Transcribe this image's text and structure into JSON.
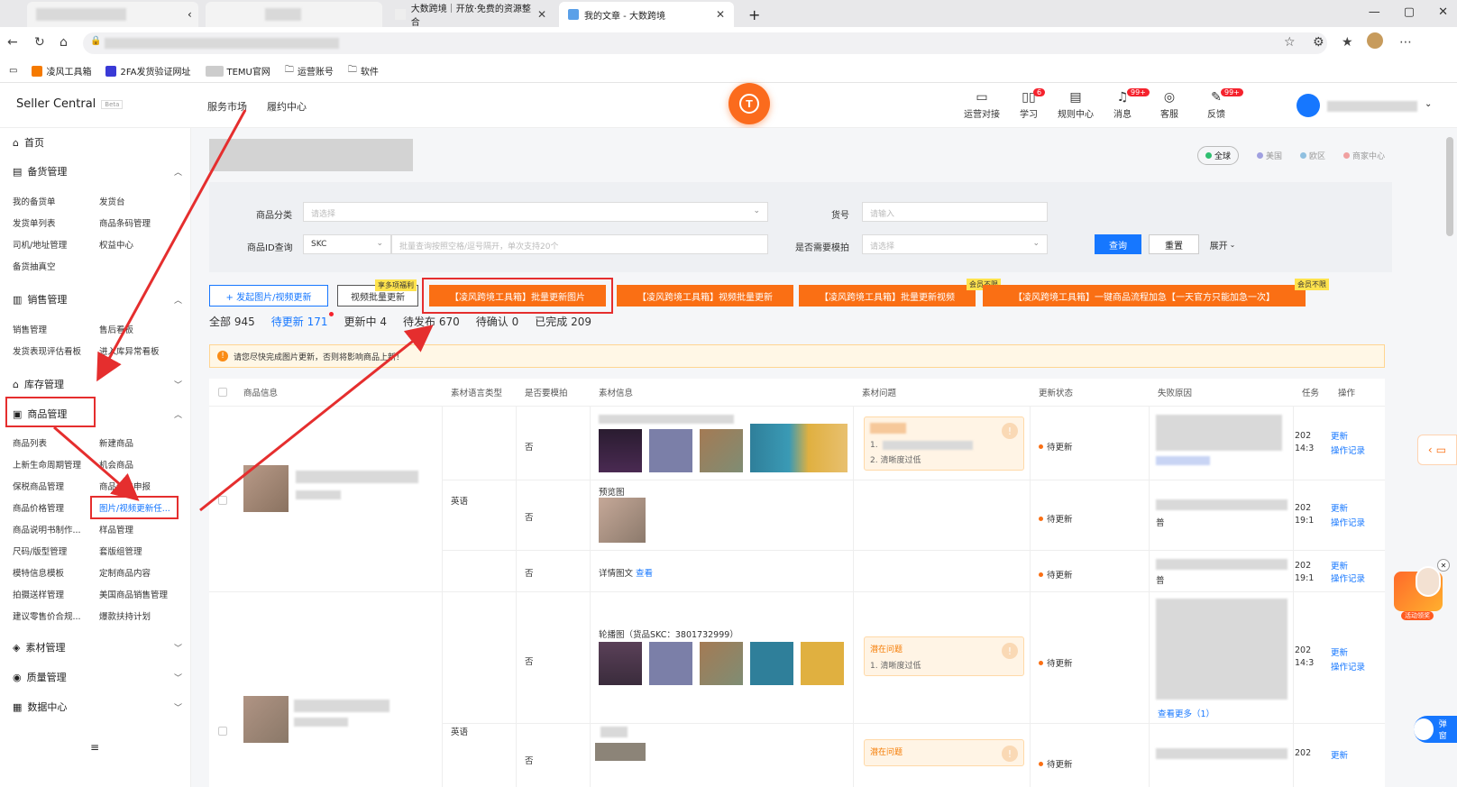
{
  "browser": {
    "tabs": [
      {
        "label": "大数跨境｜开放·免费的资源整合"
      },
      {
        "label": "我的文章 - 大数跨境"
      }
    ],
    "new_tab": "+",
    "window_controls": [
      "—",
      "▢",
      "✕"
    ]
  },
  "bookmarks": [
    {
      "label": "凌风工具箱",
      "color": "#f57a00"
    },
    {
      "label": "2FA发货验证网址",
      "color": "#3a3ad6"
    },
    {
      "label": "TEMU官网",
      "color": "#cccccc"
    },
    {
      "label": "运营账号",
      "color": ""
    },
    {
      "label": "软件",
      "color": ""
    }
  ],
  "header": {
    "brand": "Seller Central",
    "beta": "Beta",
    "nav": [
      "服务市场",
      "履约中心"
    ],
    "icons": [
      {
        "label": "运营对接",
        "icon": "chat-icon",
        "badge": ""
      },
      {
        "label": "学习",
        "icon": "book-icon",
        "badge": "6"
      },
      {
        "label": "规则中心",
        "icon": "document-icon",
        "badge": ""
      },
      {
        "label": "消息",
        "icon": "bell-icon",
        "badge": "99+"
      },
      {
        "label": "客服",
        "icon": "headset-icon",
        "badge": ""
      },
      {
        "label": "反馈",
        "icon": "edit-icon",
        "badge": "99+"
      }
    ]
  },
  "sidebar": {
    "home": "首页",
    "groups": [
      {
        "label": "备货管理",
        "items": [
          "我的备货单",
          "发货台",
          "发货单列表",
          "商品条码管理",
          "司机/地址管理",
          "权益中心",
          "备货抽真空"
        ]
      },
      {
        "label": "销售管理",
        "items": [
          "销售管理",
          "售后看板",
          "发货表现评估看板",
          "进入库异常看板"
        ]
      },
      {
        "label": "库存管理",
        "items": []
      },
      {
        "label": "商品管理",
        "items": [
          "商品列表",
          "新建商品",
          "上新生命周期管理",
          "机会商品",
          "保税商品管理",
          "商品价格申报",
          "商品价格管理",
          "图片/视频更新任...",
          "商品说明书制作...",
          "样品管理",
          "尺码/版型管理",
          "套版组管理",
          "模特信息模板",
          "定制商品内容",
          "拍摄送样管理",
          "美国商品销售管理",
          "建议零售价合规...",
          "爆款扶持计划"
        ]
      },
      {
        "label": "素材管理",
        "items": []
      },
      {
        "label": "质量管理",
        "items": []
      },
      {
        "label": "数据中心",
        "items": []
      }
    ]
  },
  "region": {
    "options": [
      "全球",
      "美国",
      "欧区",
      "商家中心"
    ]
  },
  "filters": {
    "category_label": "商品分类",
    "category_placeholder": "请选择",
    "sku_label": "货号",
    "sku_placeholder": "请输入",
    "id_label": "商品ID查询",
    "id_type": "SKC",
    "id_placeholder": "批量查询按照空格/逗号隔开，单次支持20个",
    "model_label": "是否需要模拍",
    "model_placeholder": "请选择",
    "query": "查询",
    "reset": "重置",
    "expand": "展开"
  },
  "toolbar": {
    "upload": "+ 发起图片/视频更新",
    "video_batch": "视频批量更新",
    "ribbon_1": "享多项福利",
    "b1": "【凌风跨境工具箱】批量更新图片",
    "b2": "【凌风跨境工具箱】视频批量更新",
    "b3": "【凌风跨境工具箱】批量更新视频",
    "b4": "【凌风跨境工具箱】一键商品流程加急【一天官方只能加急一次】",
    "ribbon_2": "会员不限",
    "ribbon_3": "会员不限"
  },
  "status_tabs": [
    {
      "label": "全部",
      "count": "945"
    },
    {
      "label": "待更新",
      "count": "171"
    },
    {
      "label": "更新中",
      "count": "4"
    },
    {
      "label": "待发布",
      "count": "670"
    },
    {
      "label": "待确认",
      "count": "0"
    },
    {
      "label": "已完成",
      "count": "209"
    }
  ],
  "notice": "请您尽快完成图片更新，否则将影响商品上新！",
  "table": {
    "headers": [
      "商品信息",
      "素材语言类型",
      "是否要模拍",
      "素材信息",
      "素材问题",
      "更新状态",
      "失败原因",
      "任务",
      "操作"
    ],
    "rows": [
      {
        "lang": "英语",
        "model": "否",
        "material": "",
        "issue_title": "",
        "issue_lines": [
          "1.",
          "2. 清晰度过低"
        ],
        "status": "待更新",
        "task": "202",
        "time": "14:3",
        "op1": "更新",
        "op2": "操作记录"
      },
      {
        "lang": "",
        "model": "否",
        "material": "预览图",
        "issue_title": "",
        "issue_lines": [],
        "status": "待更新",
        "task": "202",
        "time": "19:1",
        "op1": "更新",
        "op2": "操作记录",
        "fail_word": "普"
      },
      {
        "lang": "",
        "model": "否",
        "material": "详情图文",
        "material_link": "查看",
        "issue_title": "",
        "issue_lines": [],
        "status": "待更新",
        "task": "202",
        "time": "19:1",
        "op1": "更新",
        "op2": "操作记录",
        "fail_word": "普"
      },
      {
        "lang": "英语",
        "model": "否",
        "material": "轮播图（货品SKC：3801732999）",
        "issue_title": "潜在问题",
        "issue_lines": [
          "1. 清晰度过低"
        ],
        "status": "待更新",
        "task": "202",
        "time": "14:3",
        "op1": "更新",
        "op2": "操作记录",
        "more": "查看更多（1）"
      },
      {
        "lang": "",
        "model": "否",
        "material": "",
        "issue_title": "潜在问题",
        "issue_lines": [],
        "status": "待更新",
        "task": "202",
        "time": "",
        "op1": "更新",
        "op2": ""
      }
    ]
  },
  "float": {
    "gift_label": "活动领奖",
    "toggle": "弹窗"
  },
  "colors": {
    "accent": "#1677ff",
    "orange": "#fa6f14",
    "red": "#e52e2e"
  }
}
